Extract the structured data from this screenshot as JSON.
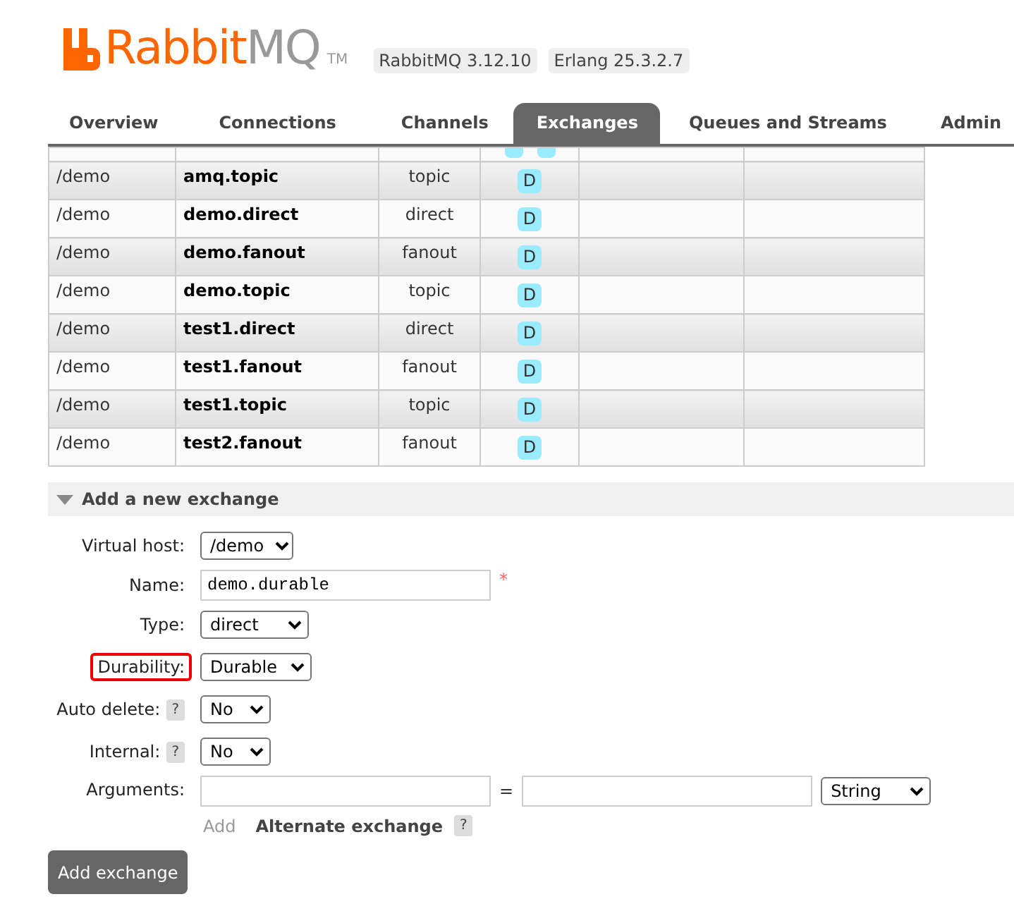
{
  "header": {
    "logo": {
      "main": "Rabbit",
      "suffix": "MQ",
      "mark": "TM"
    },
    "badges": [
      "RabbitMQ 3.12.10",
      "Erlang 25.3.2.7"
    ]
  },
  "tabs": [
    {
      "label": "Overview",
      "selected": false
    },
    {
      "label": "Connections",
      "selected": false
    },
    {
      "label": "Channels",
      "selected": false
    },
    {
      "label": "Exchanges",
      "selected": true
    },
    {
      "label": "Queues and Streams",
      "selected": false
    },
    {
      "label": "Admin",
      "selected": false
    }
  ],
  "exchanges": {
    "rows": [
      {
        "vhost": "/demo",
        "name": "amq.topic",
        "type": "topic",
        "features": "D"
      },
      {
        "vhost": "/demo",
        "name": "demo.direct",
        "type": "direct",
        "features": "D"
      },
      {
        "vhost": "/demo",
        "name": "demo.fanout",
        "type": "fanout",
        "features": "D"
      },
      {
        "vhost": "/demo",
        "name": "demo.topic",
        "type": "topic",
        "features": "D"
      },
      {
        "vhost": "/demo",
        "name": "test1.direct",
        "type": "direct",
        "features": "D"
      },
      {
        "vhost": "/demo",
        "name": "test1.fanout",
        "type": "fanout",
        "features": "D"
      },
      {
        "vhost": "/demo",
        "name": "test1.topic",
        "type": "topic",
        "features": "D"
      },
      {
        "vhost": "/demo",
        "name": "test2.fanout",
        "type": "fanout",
        "features": "D"
      }
    ]
  },
  "add_exchange": {
    "title": "Add a new exchange",
    "expanded": true,
    "fields": [
      {
        "kind": "select",
        "label": "Virtual host:",
        "value": "/demo",
        "highlighted": false
      },
      {
        "kind": "text",
        "label": "Name:",
        "value": "demo.durable",
        "required_mark": "*",
        "highlighted": false
      },
      {
        "kind": "select",
        "label": "Type:",
        "value": "direct",
        "highlighted": false
      },
      {
        "kind": "select",
        "label": "Durability:",
        "value": "Durable",
        "highlighted": true
      },
      {
        "kind": "select",
        "label": "Auto delete:",
        "help": "?",
        "value": "No",
        "highlighted": false
      },
      {
        "kind": "select",
        "label": "Internal:",
        "help": "?",
        "value": "No",
        "highlighted": false
      },
      {
        "kind": "arguments",
        "label": "Arguments:",
        "separator": "=",
        "value_type": "String",
        "add_label": "Add",
        "suggestion": "Alternate exchange",
        "suggestion_help": "?",
        "highlighted": false
      }
    ],
    "submit": "Add exchange"
  }
}
